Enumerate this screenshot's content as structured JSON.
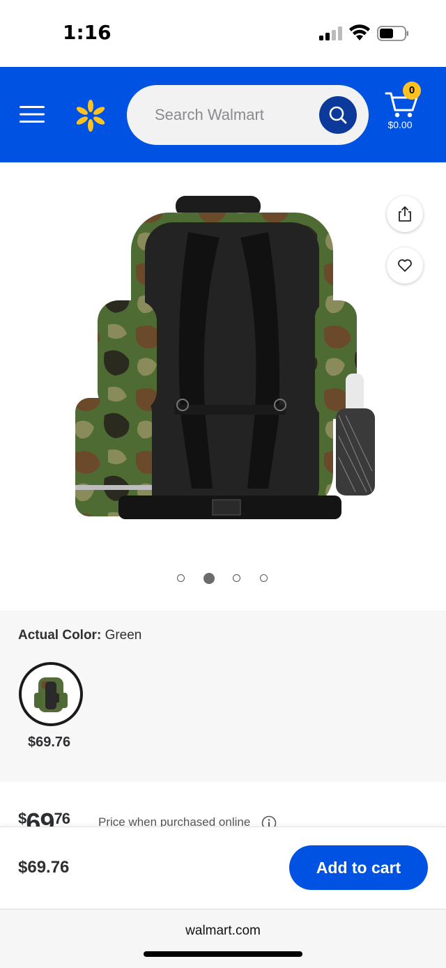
{
  "status_bar": {
    "time": "1:16"
  },
  "header": {
    "search_placeholder": "Search Walmart",
    "cart_count": "0",
    "cart_total": "$0.00",
    "brand_color": "#0053e2",
    "spark_color": "#ffc220"
  },
  "gallery": {
    "image_count": 4,
    "active_index": 1
  },
  "variant": {
    "color_label": "Actual Color:",
    "color_value": "Green",
    "swatch_price": "$69.76"
  },
  "price": {
    "currency": "$",
    "dollars": "69",
    "cents": "76",
    "note": "Price when purchased online"
  },
  "cart_bar": {
    "price": "$69.76",
    "add_to_cart": "Add to cart"
  },
  "browser": {
    "url": "walmart.com"
  }
}
